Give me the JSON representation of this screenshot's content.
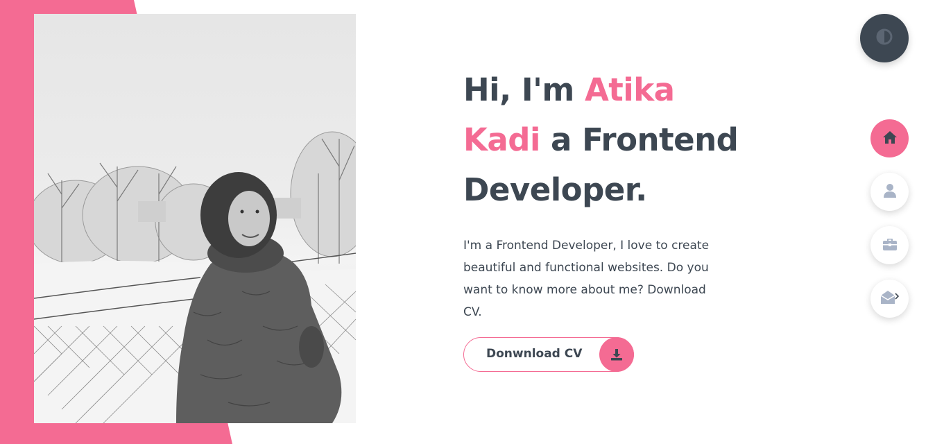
{
  "hero": {
    "title_part1": "Hi, I'm ",
    "name": "Atika Kadi",
    "title_part2": " a Frontend Developer.",
    "description": "I'm a Frontend Developer, I love to create beautiful and functional websites. Do you want to know more about me? Download CV."
  },
  "download_button": {
    "label": "Donwnload CV",
    "icon": "download-icon"
  },
  "theme_toggle": {
    "icon": "contrast-icon"
  },
  "nav": {
    "items": [
      {
        "name": "home",
        "icon": "home-icon",
        "active": true
      },
      {
        "name": "about",
        "icon": "user-icon",
        "active": false
      },
      {
        "name": "portfolio",
        "icon": "briefcase-icon",
        "active": false
      },
      {
        "name": "contact",
        "icon": "envelope-open-icon",
        "active": false
      }
    ]
  },
  "colors": {
    "accent": "#f46b93",
    "text": "#3d4752",
    "nav_icon_inactive": "#a9b4c7",
    "background": "#ffffff"
  }
}
